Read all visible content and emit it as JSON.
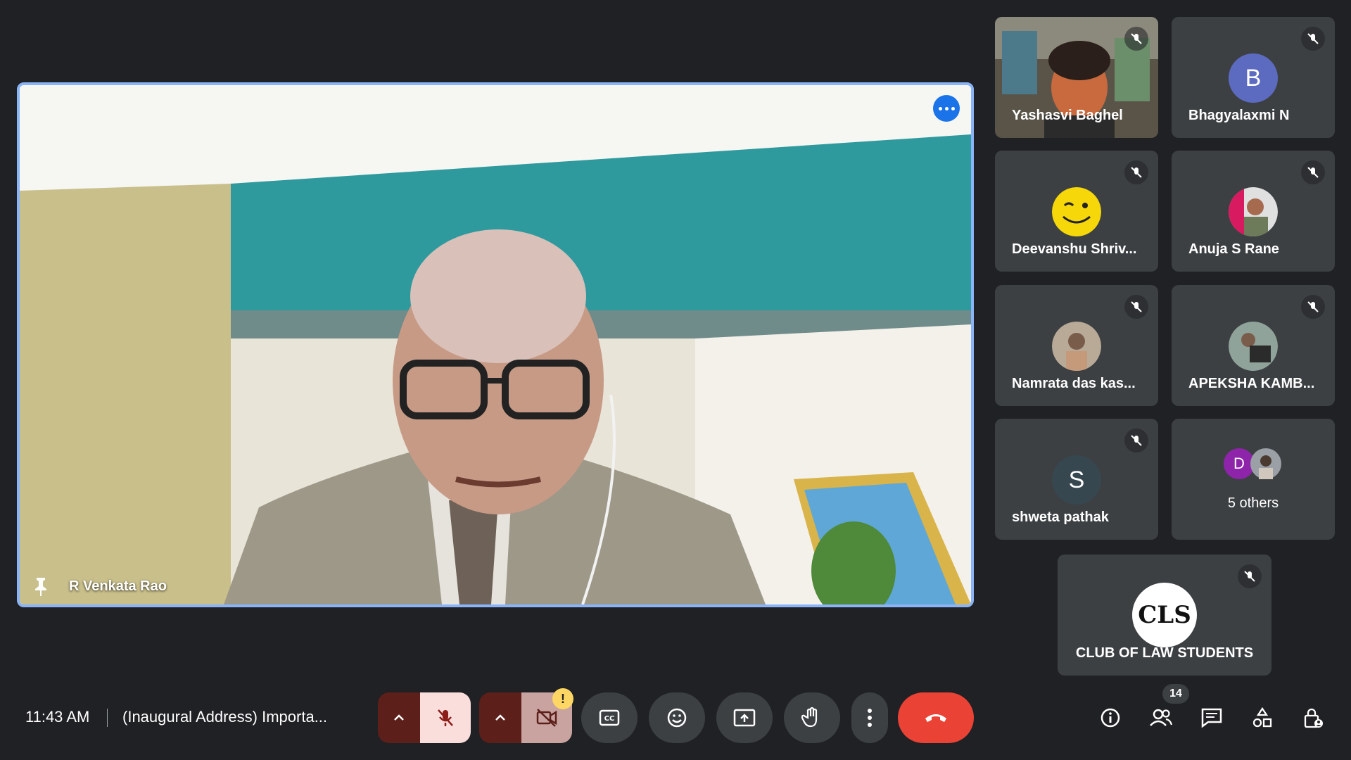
{
  "main_speaker": {
    "name": "R Venkata Rao"
  },
  "participants": [
    {
      "name": "Yashasvi Baghel",
      "type": "video"
    },
    {
      "name": "Bhagyalaxmi N",
      "type": "initial",
      "initial": "B",
      "color": "#5c6bc0"
    },
    {
      "name": "Deevanshu Shriv...",
      "type": "emoji"
    },
    {
      "name": "Anuja S Rane",
      "type": "photo"
    },
    {
      "name": "Namrata das kas...",
      "type": "photo"
    },
    {
      "name": "APEKSHA KAMB...",
      "type": "photo"
    },
    {
      "name": "shweta pathak",
      "type": "initial",
      "initial": "S",
      "color": "#37474f"
    },
    {
      "name": "5 others",
      "type": "group",
      "initial": "D",
      "color": "#8e24aa"
    }
  ],
  "club_tile": {
    "name": "CLUB OF LAW STUDENTS",
    "logo": "CLS"
  },
  "bottom_bar": {
    "time": "11:43 AM",
    "meeting_title": "(Inaugural Address) Importa...",
    "people_count": "14"
  },
  "colors": {
    "accent": "#8ab4f8",
    "end_call": "#ea4335",
    "mic_off": "#f9dedc"
  }
}
